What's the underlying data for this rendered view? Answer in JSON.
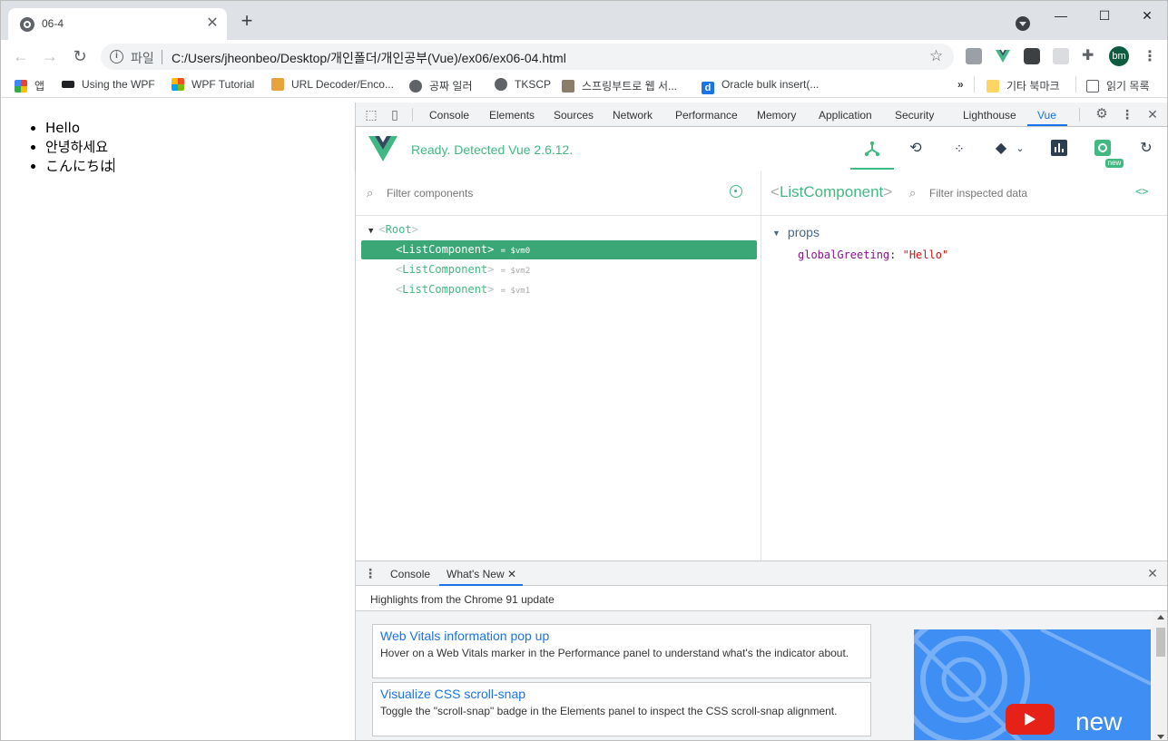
{
  "browser": {
    "tab_title": "06-4",
    "tab_close": "✕",
    "new_tab": "+",
    "window_controls": [
      "—",
      "☐",
      "✕"
    ],
    "url_scheme": "파일",
    "url": "C:/Users/jheonbeo/Desktop/개인폴더/개인공부(Vue)/ex06/ex06-04.html",
    "avatar_initials": "bm"
  },
  "bookmarks": {
    "items": [
      {
        "label": "앱",
        "icon": "apps-grid-icon"
      },
      {
        "label": "Using the WPF",
        "icon": "graduation-cap-icon"
      },
      {
        "label": "WPF Tutorial",
        "icon": "windows-logo-icon"
      },
      {
        "label": "URL Decoder/Enco...",
        "icon": "site-favicon-icon"
      },
      {
        "label": "공짜 일러",
        "icon": "globe-icon"
      },
      {
        "label": "TKSCP",
        "icon": "globe-icon"
      },
      {
        "label": "스프링부트로 웹 서...",
        "icon": "site-favicon-icon"
      },
      {
        "label": "Oracle bulk insert(...",
        "icon": "d-logo-icon"
      }
    ],
    "overflow": "»",
    "other_folder": "기타 북마크",
    "reading_list": "읽기 목록"
  },
  "page": {
    "items": [
      "Hello",
      "안녕하세요",
      "こんにちは"
    ]
  },
  "devtools": {
    "tabs": [
      "Console",
      "Elements",
      "Sources",
      "Network",
      "Performance",
      "Memory",
      "Application",
      "Security",
      "Lighthouse",
      "Vue"
    ],
    "active_tab": "Vue",
    "vue_status": "Ready. Detected Vue 2.6.12.",
    "new_badge": "new",
    "filter_components_placeholder": "Filter components",
    "filter_inspected_placeholder": "Filter inspected data",
    "tree": {
      "root": "Root",
      "children": [
        {
          "name": "ListComponent",
          "vm": "= $vm0",
          "selected": true
        },
        {
          "name": "ListComponent",
          "vm": "= $vm2",
          "selected": false
        },
        {
          "name": "ListComponent",
          "vm": "= $vm1",
          "selected": false
        }
      ]
    },
    "inspected": {
      "component": "ListComponent",
      "section": "props",
      "prop_key": "globalGreeting",
      "prop_value": "\"Hello\""
    },
    "drawer": {
      "tabs": [
        "Console",
        "What's New"
      ],
      "close_tab": "✕",
      "highlights": "Highlights from the Chrome 91 update",
      "cards": [
        {
          "title": "Web Vitals information pop up",
          "desc": "Hover on a Web Vitals marker in the Performance panel to understand what's the indicator about."
        },
        {
          "title": "Visualize CSS scroll-snap",
          "desc": "Toggle the \"scroll-snap\" badge in the Elements panel to inspect the CSS scroll-snap alignment."
        }
      ],
      "video_word": "new"
    }
  },
  "colors": {
    "vue_green": "#42b983",
    "selected_row": "#3ba776",
    "link_blue": "#1a73e8"
  }
}
